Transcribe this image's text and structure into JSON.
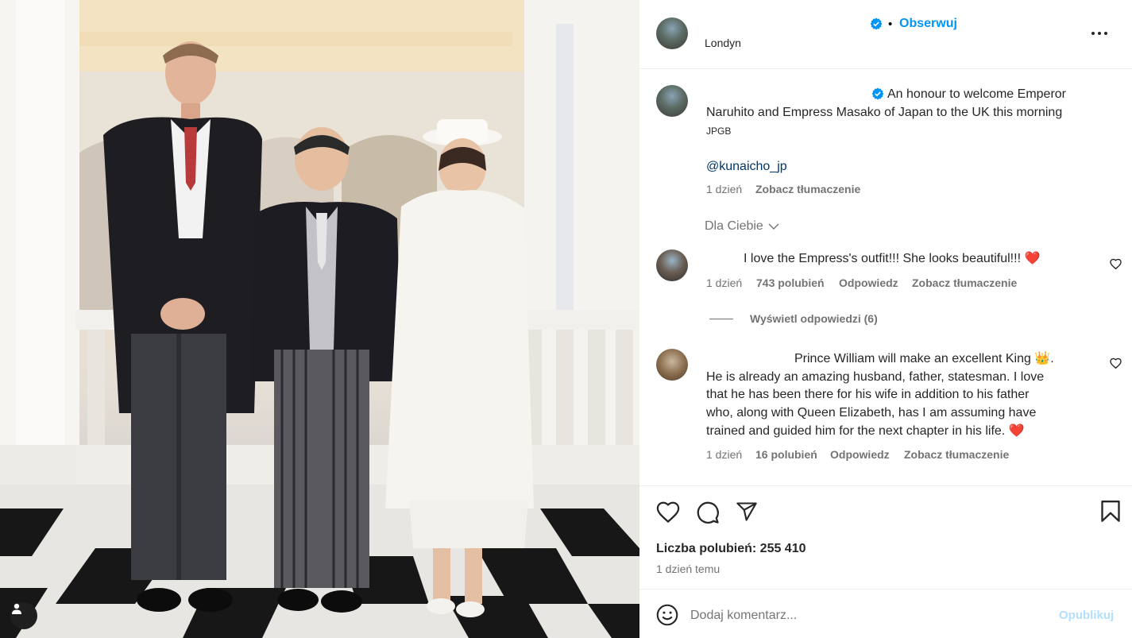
{
  "header": {
    "follow_label": "Obserwuj",
    "location": "Londyn"
  },
  "caption": {
    "text_line1": "An honour to welcome Emperor",
    "text_line2": "Naruhito and Empress Masako of Japan to the UK this morning",
    "credit": "JPGB",
    "mention": "@kunaicho_jp",
    "time": "1 dzień",
    "translate": "Zobacz tłumaczenie"
  },
  "feed_filter": {
    "label": "Dla Ciebie"
  },
  "comments": [
    {
      "text": "I love the Empress's outfit!!! She looks beautiful!!! ❤️",
      "time": "1 dzień",
      "likes": "743 polubień",
      "reply": "Odpowiedz",
      "translate": "Zobacz tłumaczenie",
      "view_replies": "Wyświetl odpowiedzi (6)"
    },
    {
      "line1": "Prince William will make an excellent King 👑.",
      "line2": "He is already an amazing husband, father, statesman. I love",
      "line3": "that he has been there for his wife in addition to his father",
      "line4": "who, along with Queen Elizabeth, has I am assuming have",
      "line5": "trained and guided him for the next chapter in his life. ❤️",
      "time": "1 dzień",
      "likes": "16 polubień",
      "reply": "Odpowiedz",
      "translate": "Zobacz tłumaczenie"
    }
  ],
  "stats": {
    "likes": "Liczba polubień: 255 410",
    "time": "1 dzień temu"
  },
  "comment_box": {
    "placeholder": "Dodaj komentarz...",
    "post_label": "Opublikuj"
  },
  "colors": {
    "accent": "#0095f6",
    "verified": "#0095f6",
    "like_heart": "#ed4956"
  },
  "icons": [
    "user-tag-icon",
    "verified-icon",
    "more-icon",
    "chevron-down-icon",
    "heart-icon",
    "comment-icon",
    "share-icon",
    "bookmark-icon",
    "emoji-icon"
  ]
}
